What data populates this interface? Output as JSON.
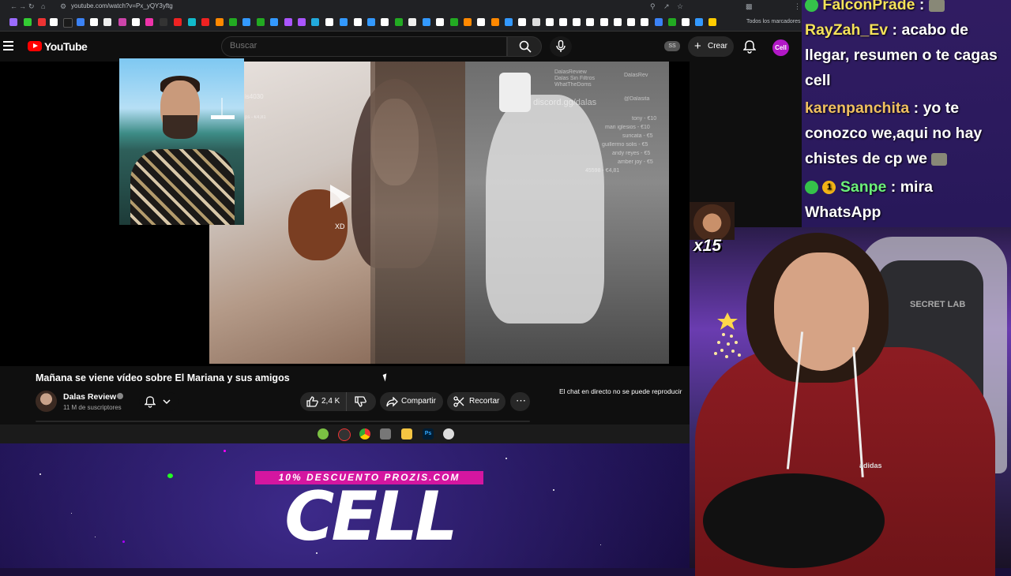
{
  "browser": {
    "url": "youtube.com/watch?v=Px_yQY3yftg",
    "bookmarks_all": "Todos los marcadores"
  },
  "youtube": {
    "logo_text": "YouTube",
    "search_placeholder": "Buscar",
    "ss_badge": "SS",
    "create_label": "Crear",
    "avatar_text": "Cell"
  },
  "video": {
    "title": "Mañana se viene vídeo sobre El Mariana y sus amigos",
    "overlay_text": "XD",
    "overlay_handle": "is4030",
    "overlay_amount": "ps - €4,81",
    "social": {
      "youtube": "DalasReview",
      "youtube_sub": "Dalas Sin Filtros",
      "youtube_sub2": "WhatTheDoms",
      "twitter": "DalasRev",
      "discord": "discord.gg/dalas",
      "instagram": "@Dalasita"
    },
    "donations": [
      "tony - €10",
      "mari iglesios - €10",
      "suricata - €5",
      "guillermo solis - €5",
      "andy reyes - €5",
      "amber joy - €5",
      "45598 - €4,81"
    ]
  },
  "channel": {
    "name": "Dalas Review",
    "subscribers": "11 M de suscriptores"
  },
  "actions": {
    "likes": "2,4 K",
    "share": "Compartir",
    "clip": "Recortar"
  },
  "live_chat_notice": "El chat en directo no se puede reproducir",
  "stream_chat": [
    {
      "user": "FalconPrade",
      "text": ""
    },
    {
      "user": "RayZah_Ev",
      "text": "acabo de llegar, resumen o te cagas cell"
    },
    {
      "user": "karenpanchita",
      "text": "yo te conozco we,aqui no hay chistes de cp we"
    },
    {
      "user": "Sanpe",
      "text": "mira WhatsApp"
    }
  ],
  "emote_multiplier": "x15",
  "webcam": {
    "chair_brand": "SECRET LAB",
    "hoodie_brand": "adidas"
  },
  "promo": {
    "discount": "10% DESCUENTO PROZIS.COM",
    "name": "CELL"
  },
  "taskbar_ps": "Ps"
}
